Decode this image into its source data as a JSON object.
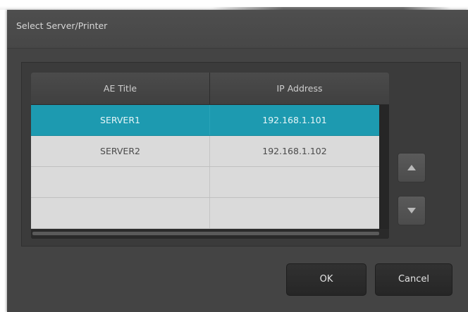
{
  "dialog": {
    "title": "Select Server/Printer"
  },
  "table": {
    "columns": [
      "AE Title",
      "IP Address"
    ],
    "rows": [
      {
        "ae_title": "SERVER1",
        "ip": "192.168.1.101",
        "selected": true
      },
      {
        "ae_title": "SERVER2",
        "ip": "192.168.1.102",
        "selected": false
      },
      {
        "ae_title": "",
        "ip": "",
        "selected": false
      },
      {
        "ae_title": "",
        "ip": "",
        "selected": false
      }
    ]
  },
  "side_buttons": {
    "up_icon": "triangle-up-icon",
    "down_icon": "triangle-down-icon"
  },
  "buttons": {
    "ok": "OK",
    "cancel": "Cancel"
  },
  "colors": {
    "selection": "#1d9ab0",
    "dialog_bg": "#444444"
  }
}
